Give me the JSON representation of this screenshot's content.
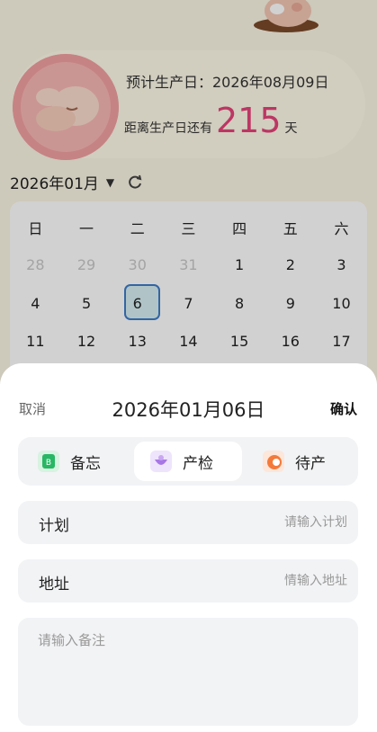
{
  "due_card": {
    "due_date_label": "预计生产日：2026年08月09日",
    "days_prefix": "距离生产日还有",
    "days_value": "215",
    "days_suffix": "天"
  },
  "calendar": {
    "month_label": "2026年01月",
    "weekdays": [
      "日",
      "一",
      "二",
      "三",
      "四",
      "五",
      "六"
    ],
    "rows": [
      [
        "28",
        "29",
        "30",
        "31",
        "1",
        "2",
        "3"
      ],
      [
        "4",
        "5",
        "6",
        "7",
        "8",
        "9",
        "10"
      ],
      [
        "11",
        "12",
        "13",
        "14",
        "15",
        "16",
        "17"
      ]
    ],
    "selected_day": "6"
  },
  "sheet": {
    "cancel_label": "取消",
    "title": "2026年01月06日",
    "confirm_label": "确认",
    "types": [
      {
        "label": "备忘",
        "icon": "memo-icon",
        "active": false
      },
      {
        "label": "产检",
        "icon": "checkup-icon",
        "active": true
      },
      {
        "label": "待产",
        "icon": "waiting-birth-icon",
        "active": false
      }
    ],
    "plan_label": "计划",
    "plan_placeholder": "请输入计划",
    "address_label": "地址",
    "address_placeholder": "情输入地址",
    "notes_placeholder": "请输入备注"
  },
  "colors": {
    "accent_days": "#e6437a",
    "selected_border": "#3d7cc9",
    "selected_fill": "#d7eff3"
  }
}
